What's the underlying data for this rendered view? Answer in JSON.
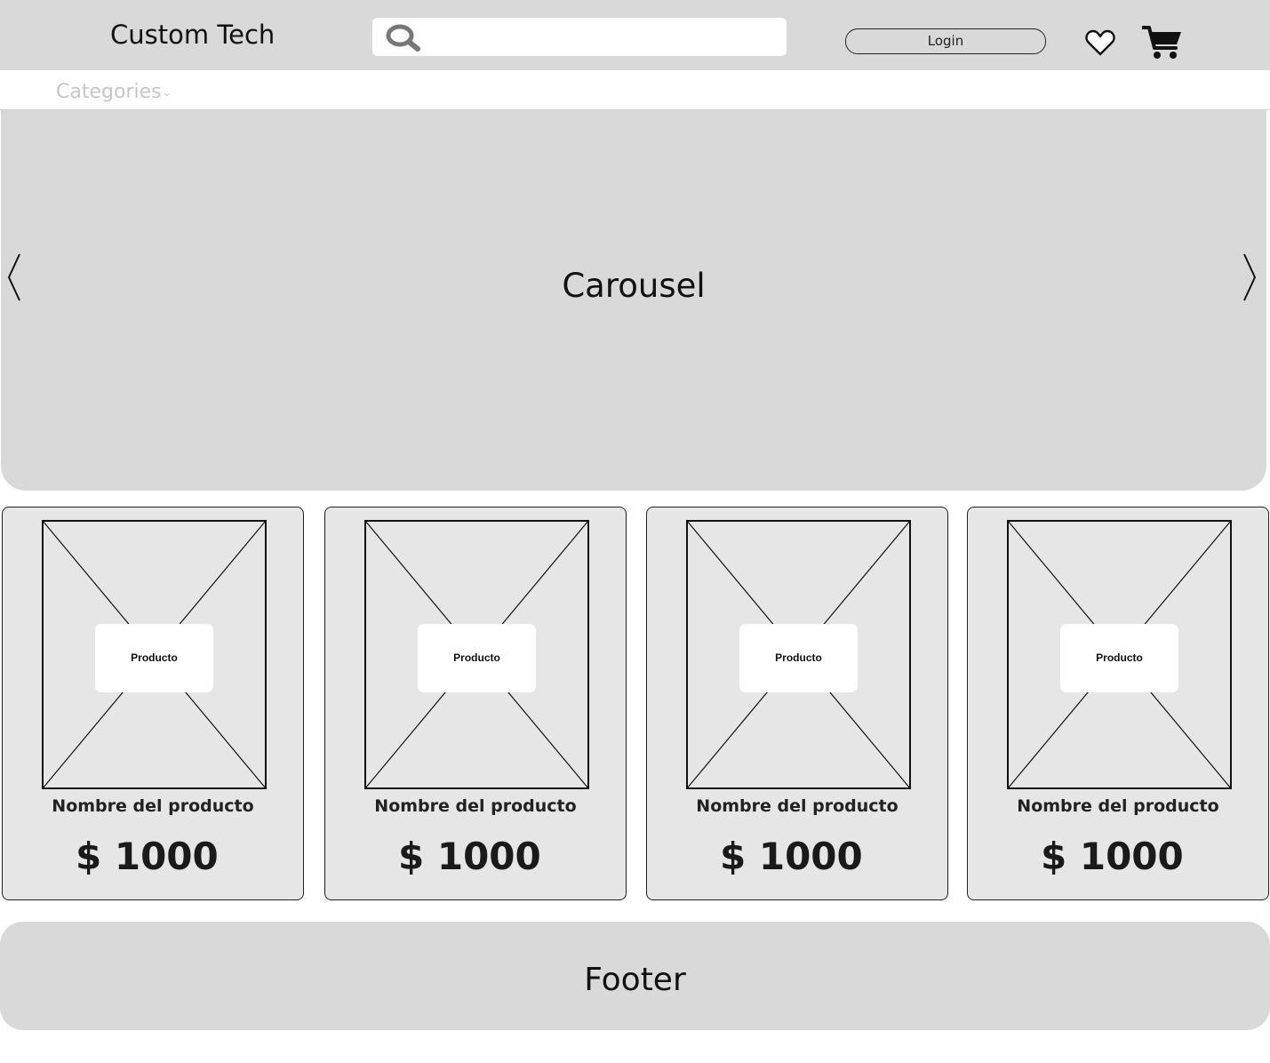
{
  "header": {
    "brand": "Custom Tech",
    "search_placeholder": "",
    "login_label": "Login",
    "icons": [
      "search-icon",
      "heart-icon",
      "cart-icon"
    ]
  },
  "nav": {
    "categories_label": "Categories",
    "categories_chevron": "⌄"
  },
  "carousel": {
    "label": "Carousel",
    "prev_icon": "chevron-left-icon",
    "next_icon": "chevron-right-icon"
  },
  "products": [
    {
      "image_label": "Producto",
      "name": "Nombre del producto",
      "price": "$ 1000"
    },
    {
      "image_label": "Producto",
      "name": "Nombre del producto",
      "price": "$ 1000"
    },
    {
      "image_label": "Producto",
      "name": "Nombre del producto",
      "price": "$ 1000"
    },
    {
      "image_label": "Producto",
      "name": "Nombre del producto",
      "price": "$ 1000"
    }
  ],
  "footer": {
    "label": "Footer"
  },
  "colors": {
    "header_bg": "#d9d9d9",
    "card_bg": "#e6e6e6",
    "categories_text": "#c7c7c7"
  }
}
